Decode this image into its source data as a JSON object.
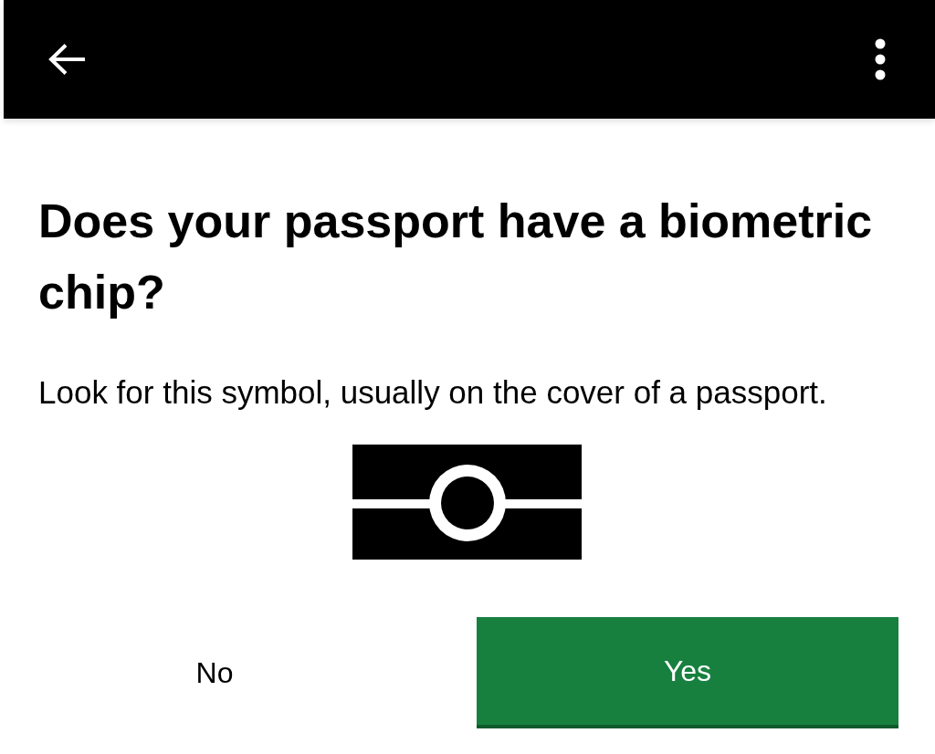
{
  "heading": "Does your passport have a biometric chip?",
  "instruction": "Look for this symbol, usually on the cover of a passport.",
  "buttons": [
    {
      "label": "No",
      "kind": "secondary"
    },
    {
      "label": "Yes",
      "kind": "primary"
    }
  ]
}
